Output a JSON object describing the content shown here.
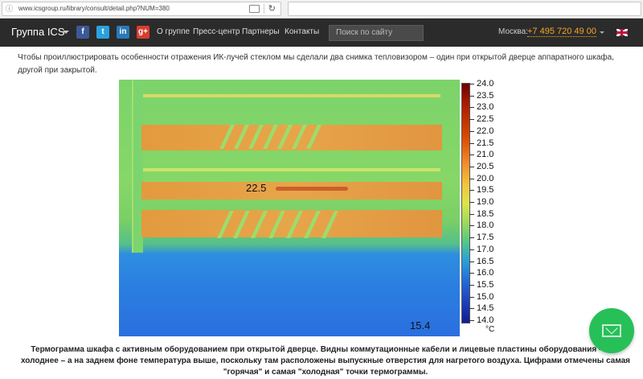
{
  "browser": {
    "url": "www.icsgroup.ru/library/consult/detail.php?NUM=380",
    "search_placeholder": ""
  },
  "nav": {
    "brand": "Группа ICS",
    "social": [
      "f",
      "t",
      "in",
      "g+"
    ],
    "links": [
      "О группе",
      "Пресс-центр",
      "Партнеры",
      "Контакты"
    ],
    "search_placeholder": "Поиск по сайту",
    "city": "Москва:",
    "phone": "+7 495 720 49 00",
    "language_flag": "uk-flag-icon"
  },
  "article": {
    "intro": "Чтобы проиллюстрировать особенности отражения ИК-лучей стеклом мы сделали два снимка тепловизором – один при открытой дверце аппаратного шкафа, другой при закрытой.",
    "caption": "Термограмма шкафа с активным оборудованием при открытой дверце. Видны коммутационные кабели и лицевые пластины оборудования – они холоднее – а на заднем фоне температура выше, поскольку там расположены выпускные отверстия для нагретого воздуха. Цифрами отмечены самая \"горячая\" и самая \"холодная\" точки термограммы."
  },
  "thermogram": {
    "hot_point": "22.5",
    "cold_point": "15.4",
    "scale_unit": "°C",
    "scale_labels": [
      "24.0",
      "23.5",
      "23.0",
      "22.5",
      "22.0",
      "21.5",
      "21.0",
      "20.5",
      "20.0",
      "19.5",
      "19.0",
      "18.5",
      "18.0",
      "17.5",
      "17.0",
      "16.5",
      "16.0",
      "15.5",
      "15.0",
      "14.5",
      "14.0"
    ]
  },
  "colors": {
    "nav_bg": "#2b2b2b",
    "phone": "#f5a623",
    "fab": "#27c058"
  }
}
